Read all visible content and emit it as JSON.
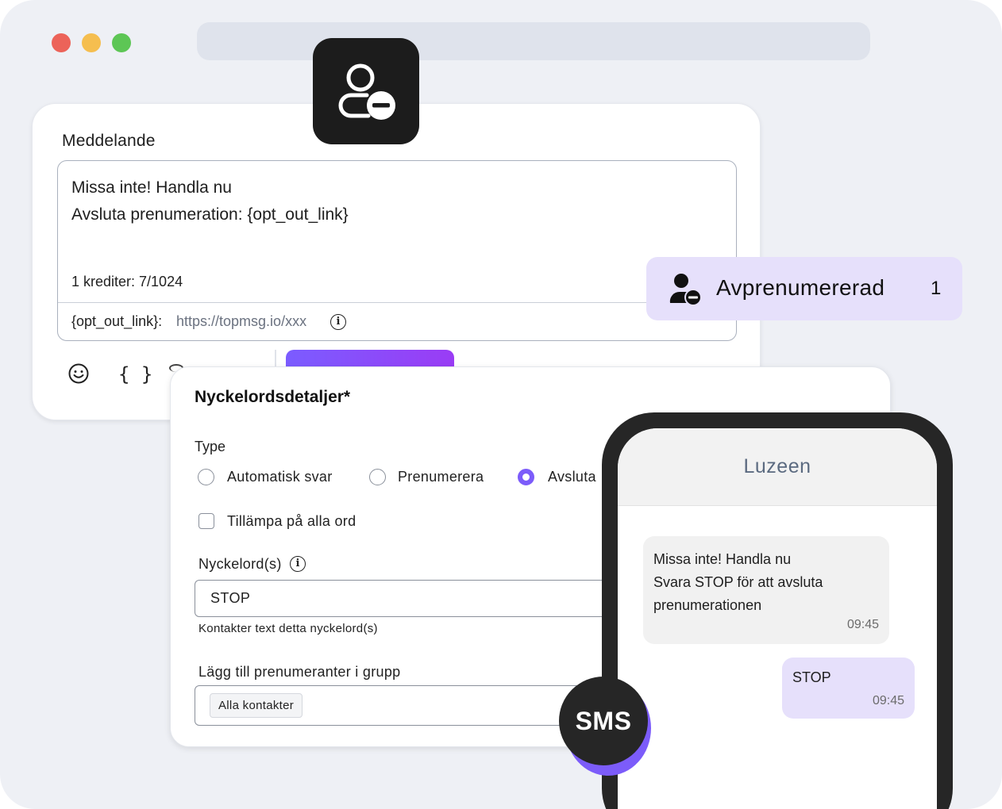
{
  "message_card": {
    "label": "Meddelande",
    "line1": "Missa inte! Handla nu",
    "line2": "Avsluta prenumeration: {opt_out_link}",
    "credits": "1 krediter: 7/1024",
    "optout_key": "{opt_out_link}:",
    "optout_url": "https://topmsg.io/xxx",
    "toolbar_icons": [
      "emoji-icon",
      "braces-icon",
      "person-icon"
    ]
  },
  "unsubscribe_tile": {
    "icon": "user-minus-icon"
  },
  "unsubscribed_pill": {
    "label": "Avprenumererad",
    "count": "1",
    "icon": "user-minus-icon"
  },
  "keyword_card": {
    "title": "Nyckelordsdetaljer*",
    "type_label": "Type",
    "type_options": [
      {
        "label": "Automatisk svar",
        "selected": false
      },
      {
        "label": "Prenumerera",
        "selected": false
      },
      {
        "label": "Avsluta",
        "selected": true
      }
    ],
    "apply_all_label": "Tillämpa på alla ord",
    "keywords_label": "Nyckelord(s)",
    "keyword_value": "STOP",
    "keyword_help": "Kontakter text detta nyckelord(s)",
    "group_label": "Lägg till prenumeranter i grupp",
    "group_chip": "Alla kontakter"
  },
  "phone": {
    "contact_name": "Luzeen",
    "incoming": {
      "lines": [
        "Missa inte! Handla nu",
        "Svara STOP för att avsluta",
        "prenumerationen"
      ],
      "time": "09:45"
    },
    "outgoing": {
      "text": "STOP",
      "time": "09:45"
    }
  },
  "sms_badge": {
    "label": "SMS"
  },
  "colors": {
    "accent": "#7c5cfa",
    "pill_bg": "#e6e0fb",
    "dark": "#262626",
    "window_bg": "#eef0f5"
  }
}
